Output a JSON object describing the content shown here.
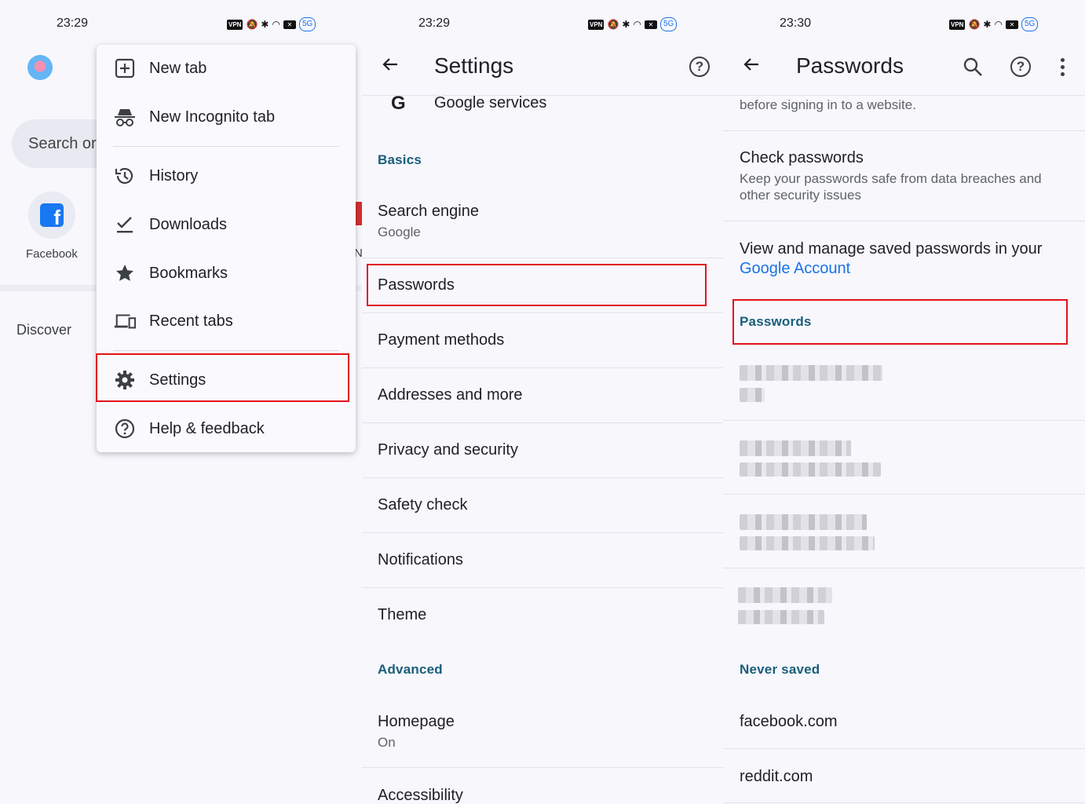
{
  "panel1": {
    "status": {
      "time": "23:29",
      "vpn": "VPN",
      "cloud": "5G"
    },
    "search_placeholder": "Search or",
    "shortcut": {
      "label": "Facebook",
      "glyph": "f"
    },
    "discover_label": "Discover",
    "edge_letter": "N",
    "menu": {
      "new_tab": "New tab",
      "new_incognito_tab": "New Incognito tab",
      "history": "History",
      "downloads": "Downloads",
      "bookmarks": "Bookmarks",
      "recent_tabs": "Recent tabs",
      "settings": "Settings",
      "help_feedback": "Help & feedback"
    }
  },
  "panel2": {
    "status": {
      "time": "23:29",
      "vpn": "VPN",
      "cloud": "5G"
    },
    "title": "Settings",
    "google_services": "Google services",
    "section_basics": "Basics",
    "search_engine": {
      "title": "Search engine",
      "value": "Google"
    },
    "passwords": "Passwords",
    "payment_methods": "Payment methods",
    "addresses": "Addresses and more",
    "privacy": "Privacy and security",
    "safety_check": "Safety check",
    "notifications": "Notifications",
    "theme": "Theme",
    "section_advanced": "Advanced",
    "homepage": {
      "title": "Homepage",
      "value": "On"
    },
    "accessibility": "Accessibility"
  },
  "panel3": {
    "status": {
      "time": "23:30",
      "vpn": "VPN",
      "cloud": "5G"
    },
    "title": "Passwords",
    "top_text": "before signing in to a website.",
    "check_passwords": {
      "title": "Check passwords",
      "desc_line1": "Keep your passwords safe from data breaches and",
      "desc_line2": "other security issues"
    },
    "manage": {
      "line1": "View and manage saved passwords in your",
      "link": "Google Account"
    },
    "section_passwords": "Passwords",
    "section_never_saved": "Never saved",
    "never_saved": [
      "facebook.com",
      "reddit.com"
    ]
  },
  "colors": {
    "highlight": "#e0131a",
    "section": "#1a5e7a",
    "link": "#1a73e8"
  }
}
